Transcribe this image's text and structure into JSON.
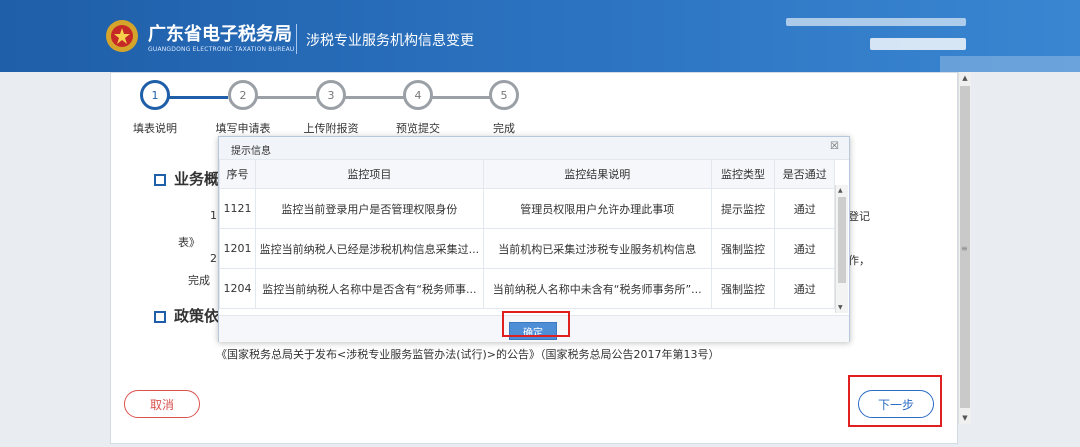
{
  "header": {
    "brand_title": "广东省电子税务局",
    "brand_subtitle": "GUANGDONG ELECTRONIC TAXATION BUREAU",
    "page_title": "涉税专业服务机构信息变更"
  },
  "steps": [
    {
      "num": "1",
      "label": "填表说明"
    },
    {
      "num": "2",
      "label": "填写申请表"
    },
    {
      "num": "3",
      "label": "上传附报资"
    },
    {
      "num": "4",
      "label": "预览提交"
    },
    {
      "num": "5",
      "label": "完成"
    }
  ],
  "sections": {
    "overview_title": "业务概",
    "policy_title": "政策依",
    "text_frag_1": "1",
    "text_frag_2": "表》",
    "text_frag_3": "2",
    "text_frag_4": "完成",
    "text_frag_right_1": "登记",
    "text_frag_right_2": "作，",
    "policy_line": "《国家税务总局关于发布<涉税专业服务监管办法(试行)>的公告》（国家税务总局公告2017年第13号）"
  },
  "buttons": {
    "cancel": "取消",
    "next": "下一步"
  },
  "modal": {
    "title": "提示信息",
    "close": "☒",
    "ok": "确定",
    "columns": [
      "序号",
      "监控项目",
      "监控结果说明",
      "监控类型",
      "是否通过"
    ],
    "rows": [
      [
        "1121",
        "监控当前登录用户是否管理权限身份",
        "管理员权限用户允许办理此事项",
        "提示监控",
        "通过"
      ],
      [
        "1201",
        "监控当前纳税人已经是涉税机构信息采集过...",
        "当前机构已采集过涉税专业服务机构信息",
        "强制监控",
        "通过"
      ],
      [
        "1204",
        "监控当前纳税人名称中是否含有“税务师事...",
        "当前纳税人名称中未含有“税务师事务所”...",
        "强制监控",
        "通过"
      ]
    ]
  },
  "colors": {
    "brand_blue": "#1f5ea8",
    "highlight_red": "#e02020"
  }
}
